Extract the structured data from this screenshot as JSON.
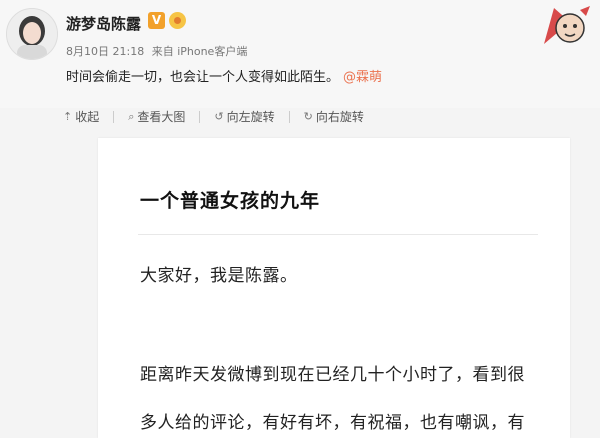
{
  "post": {
    "username": "游梦岛陈露",
    "verified_badge": "V",
    "date": "8月10日 21:18",
    "source": "来自 iPhone客户端",
    "text": "时间会偷走一切，也会让一个人变得如此陌生。",
    "mention": "@霖萌"
  },
  "toolbar": {
    "collapse": "收起",
    "view_large": "查看大图",
    "rotate_left": "向左旋转",
    "rotate_right": "向右旋转"
  },
  "article": {
    "title": "一个普通女孩的九年",
    "para1": "大家好，我是陈露。",
    "para2": "距离昨天发微博到现在已经几十个小时了，看到很",
    "para3": "多人给的评论，有好有坏，有祝福，也有嘲讽，有"
  },
  "colors": {
    "mention": "#eb7350",
    "badge_v": "#f2a12b",
    "background": "#f4f4f4",
    "article_bg": "#ffffff"
  },
  "icons": [
    "collapse-arrow-icon",
    "magnifier-icon",
    "rotate-left-icon",
    "rotate-right-icon",
    "decorative-sticker-icon"
  ]
}
